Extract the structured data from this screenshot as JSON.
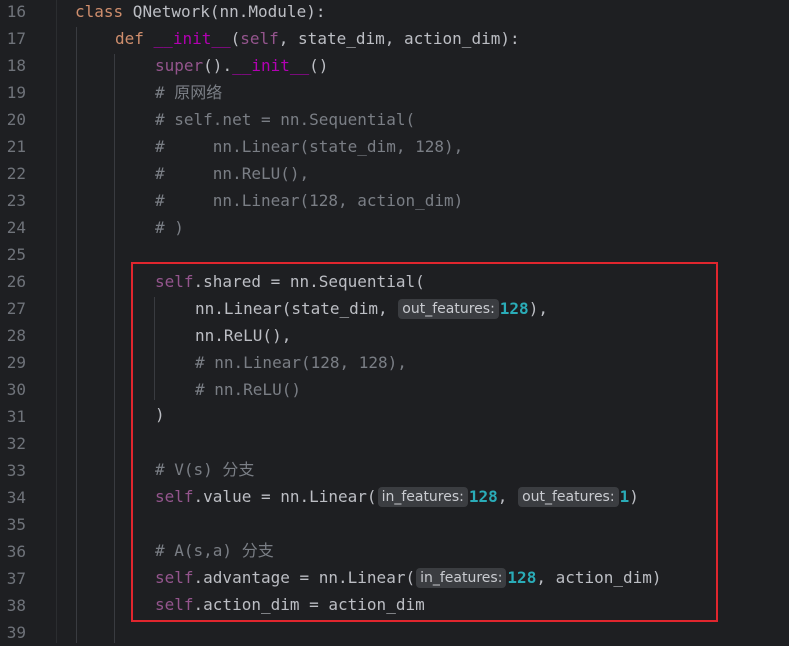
{
  "editor": {
    "line_numbers": [
      "16",
      "17",
      "18",
      "19",
      "20",
      "21",
      "22",
      "23",
      "24",
      "25",
      "26",
      "27",
      "28",
      "29",
      "30",
      "31",
      "32",
      "33",
      "34",
      "35",
      "36",
      "37",
      "38",
      "39"
    ],
    "code": {
      "l16": {
        "kw": "class",
        "rest": " QNetwork(nn.Module):"
      },
      "l17": {
        "kw": "def",
        "sp": " ",
        "name": "__init__",
        "open": "(",
        "self": "self",
        "rest": ", state_dim, action_dim):"
      },
      "l18": {
        "fn": "super",
        "mid": "().",
        "name": "__init__",
        "rest": "()"
      },
      "l19": {
        "comment": "# 原网络"
      },
      "l20": {
        "comment": "# self.net = nn.Sequential("
      },
      "l21": {
        "comment": "#     nn.Linear(state_dim, 128),"
      },
      "l22": {
        "comment": "#     nn.ReLU(),"
      },
      "l23": {
        "comment": "#     nn.Linear(128, action_dim)"
      },
      "l24": {
        "comment": "# )"
      },
      "l26": {
        "self": "self",
        "rest": ".shared = nn.Sequential("
      },
      "l27": {
        "pre": "nn.Linear(state_dim,",
        "hint": "out_features:",
        "num": "128",
        "post": "),"
      },
      "l28": {
        "pre": "nn.ReLU(),"
      },
      "l29": {
        "comment": "# nn.Linear(128, 128),"
      },
      "l30": {
        "comment": "# nn.ReLU()"
      },
      "l31": {
        "pre": ")"
      },
      "l33": {
        "comment": "# V(s) 分支"
      },
      "l34": {
        "self": "self",
        "pre": ".value = nn.Linear(",
        "hint1": "in_features:",
        "num1": "128",
        "sep": ",",
        "hint2": "out_features:",
        "num2": "1",
        "post": ")"
      },
      "l36": {
        "comment": "# A(s,a) 分支"
      },
      "l37": {
        "self": "self",
        "pre": ".advantage = nn.Linear(",
        "hint": "in_features:",
        "num": "128",
        "post": ", action_dim)"
      },
      "l38": {
        "self": "self",
        "rest": ".action_dim = action_dim"
      }
    }
  },
  "colors": {
    "background": "#1e1f22",
    "keyword": "#cf8e6d",
    "self": "#94558d",
    "dunder": "#b200b2",
    "comment": "#7a7e85",
    "number": "#2aacb8",
    "highlight_border": "#e0262e"
  }
}
